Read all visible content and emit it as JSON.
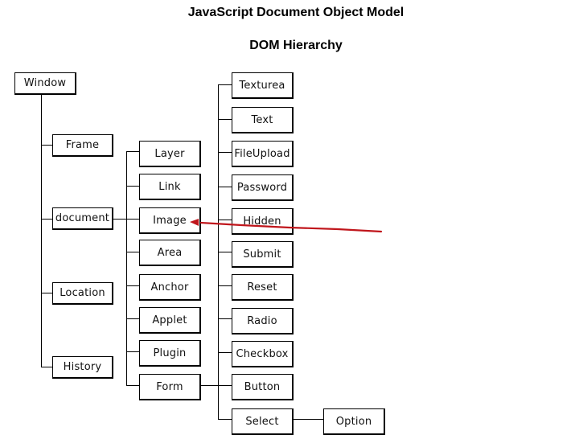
{
  "title": "JavaScript Document Object Model",
  "subtitle": "DOM Hierarchy",
  "nodes": {
    "window": "Window",
    "frame": "Frame",
    "document": "document",
    "location": "Location",
    "history": "History",
    "layer": "Layer",
    "link": "Link",
    "image": "Image",
    "area": "Area",
    "anchor": "Anchor",
    "applet": "Applet",
    "plugin": "Plugin",
    "form": "Form",
    "texturea": "Texturea",
    "text": "Text",
    "fileupload": "FileUpload",
    "password": "Password",
    "hidden": "Hidden",
    "submit": "Submit",
    "reset": "Reset",
    "radio": "Radio",
    "checkbox": "Checkbox",
    "button": "Button",
    "select": "Select",
    "option": "Option"
  },
  "annotation": {
    "type": "arrow",
    "color": "#c0161c",
    "points_to": "Image"
  }
}
